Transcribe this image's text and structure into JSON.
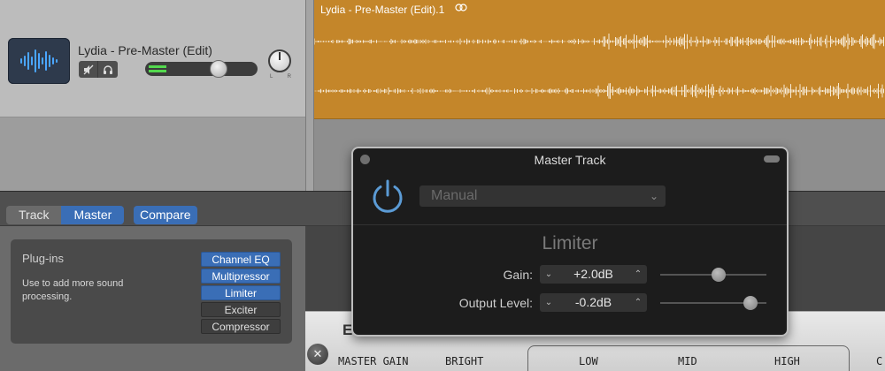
{
  "track": {
    "name": "Lydia - Pre-Master (Edit)",
    "mute_icon": "speaker-mute-icon",
    "headphones_icon": "headphones-icon",
    "volume_level": 0.65,
    "pan_left": "L",
    "pan_right": "R"
  },
  "region": {
    "title": "Lydia - Pre-Master (Edit).1",
    "loop_icon": "loop-icon",
    "color": "#c4862a"
  },
  "editor": {
    "tabs": [
      {
        "label": "Track",
        "active": false
      },
      {
        "label": "Master",
        "active": true
      }
    ],
    "compare_label": "Compare",
    "plugins": {
      "title": "Plug-ins",
      "description": "Use to add more sound processing.",
      "items": [
        {
          "label": "Channel EQ",
          "active": true
        },
        {
          "label": "Multipressor",
          "active": true
        },
        {
          "label": "Limiter",
          "active": true
        },
        {
          "label": "Exciter",
          "active": false
        },
        {
          "label": "Compressor",
          "active": false
        }
      ]
    },
    "eq": {
      "title_fragment": "E",
      "labels": [
        "MASTER GAIN",
        "BRIGHT",
        "LOW",
        "MID",
        "HIGH",
        "C"
      ]
    }
  },
  "master_window": {
    "title": "Master Track",
    "preset": "Manual",
    "plugin_name": "Limiter",
    "params": [
      {
        "label": "Gain:",
        "value": "+2.0dB",
        "slider": 0.55
      },
      {
        "label": "Output Level:",
        "value": "-0.2dB",
        "slider": 0.85
      }
    ],
    "accent": "#5b9bd5"
  }
}
